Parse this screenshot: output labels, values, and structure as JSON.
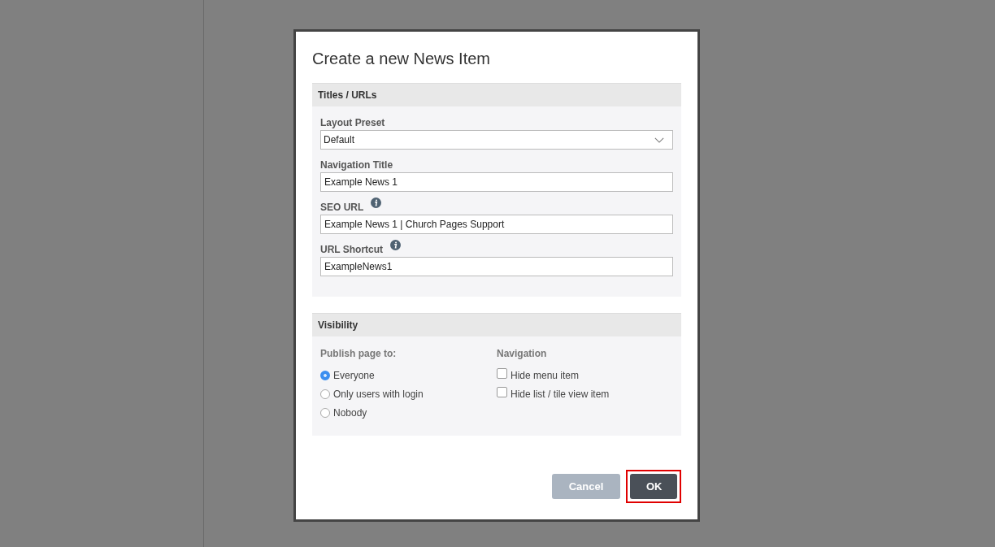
{
  "dialog": {
    "title": "Create a new News Item",
    "sections": [
      {
        "title": "Titles / URLs"
      },
      {
        "title": "Visibility"
      }
    ],
    "fields": [
      {
        "kind": "select",
        "label": "Layout Preset",
        "value": "Default",
        "info": false
      },
      {
        "kind": "text",
        "label": "Navigation Title",
        "value": "Example News 1",
        "info": false
      },
      {
        "kind": "text",
        "label": "SEO URL",
        "value": "Example News 1 | Church Pages Support",
        "info": true
      },
      {
        "kind": "text",
        "label": "URL Shortcut",
        "value": "ExampleNews1",
        "info": true
      }
    ],
    "publish": {
      "label": "Publish page to:",
      "options": [
        {
          "label": "Everyone",
          "selected": true
        },
        {
          "label": "Only users with login",
          "selected": false
        },
        {
          "label": "Nobody",
          "selected": false
        }
      ]
    },
    "navigation": {
      "label": "Navigation",
      "options": [
        {
          "label": "Hide menu item",
          "checked": false
        },
        {
          "label": "Hide list / tile view item",
          "checked": false
        }
      ]
    },
    "buttons": [
      {
        "label": "Cancel",
        "kind": "secondary",
        "disabled": true,
        "highlighted": false
      },
      {
        "label": "OK",
        "kind": "primary",
        "disabled": false,
        "highlighted": true
      }
    ]
  }
}
